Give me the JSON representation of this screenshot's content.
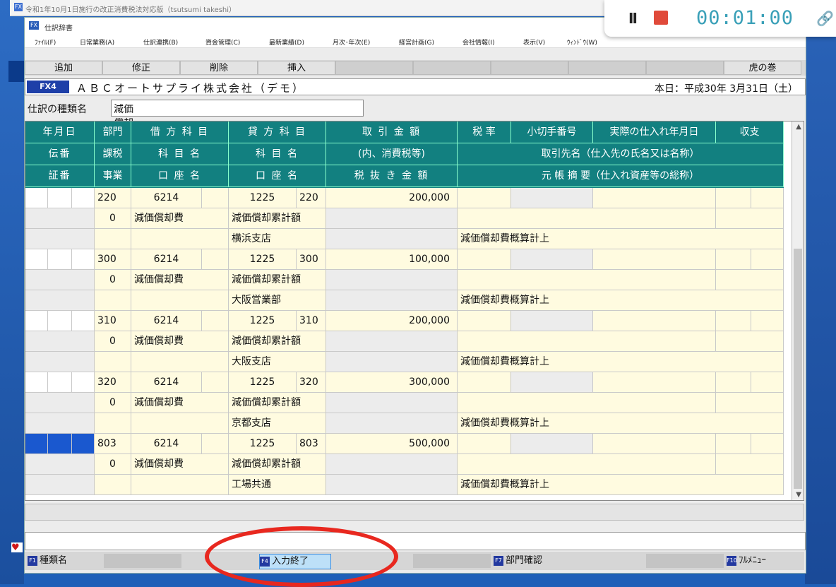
{
  "outer_title": "令和1年10月1日施行の改正消費税法対応版（tsutsumi takeshi）",
  "window_title": "仕訳辞書",
  "menu": [
    "ﾌｧｲﾙ(F)",
    "日常業務(A)",
    "仕訳連携(B)",
    "資金管理(C)",
    "最新業績(D)",
    "月次･年次(E)",
    "経営計画(G)",
    "会社情報(I)",
    "表示(V)",
    "ｳｨﾝﾄﾞｳ(W)"
  ],
  "toolbar": {
    "add": "追加",
    "edit": "修正",
    "delete": "削除",
    "insert": "挿入",
    "tora": "虎の巻"
  },
  "company": {
    "badge": "FX4",
    "name": "ＡＢＣオートサプライ株式会社（デモ）",
    "today": "本日：平成30年 3月31日（土）"
  },
  "kind": {
    "label": "仕訳の種類名",
    "value": "減価償却費　月割計上"
  },
  "headers": {
    "r1": [
      "年月日",
      "部門",
      "借 方 科 目",
      "貸 方 科 目",
      "取 引 金 額",
      "税 率",
      "小切手番号",
      "実際の仕入れ年月日",
      "収支"
    ],
    "r2": [
      "伝番",
      "課税",
      "科 目 名",
      "科 目 名",
      "(内、消費税等)",
      "取引先名（仕入先の氏名又は名称）"
    ],
    "r3": [
      "証番",
      "事業",
      "口 座 名",
      "口 座 名",
      "税 抜 き 金 額",
      "元 帳 摘 要（仕入れ資産等の総称）"
    ]
  },
  "entries": [
    {
      "dept": "220",
      "debit": "6214",
      "credit": "1225",
      "credit_dept": "220",
      "amount": "200,000",
      "tax": "0",
      "debit_name": "減価償却費",
      "credit_name": "減価償却累計額",
      "credit_account": "横浜支店",
      "memo": "減価償却費概算計上"
    },
    {
      "dept": "300",
      "debit": "6214",
      "credit": "1225",
      "credit_dept": "300",
      "amount": "100,000",
      "tax": "0",
      "debit_name": "減価償却費",
      "credit_name": "減価償却累計額",
      "credit_account": "大阪営業部",
      "memo": "減価償却費概算計上"
    },
    {
      "dept": "310",
      "debit": "6214",
      "credit": "1225",
      "credit_dept": "310",
      "amount": "200,000",
      "tax": "0",
      "debit_name": "減価償却費",
      "credit_name": "減価償却累計額",
      "credit_account": "大阪支店",
      "memo": "減価償却費概算計上"
    },
    {
      "dept": "320",
      "debit": "6214",
      "credit": "1225",
      "credit_dept": "320",
      "amount": "300,000",
      "tax": "0",
      "debit_name": "減価償却費",
      "credit_name": "減価償却累計額",
      "credit_account": "京都支店",
      "memo": "減価償却費概算計上"
    },
    {
      "dept": "803",
      "debit": "6214",
      "credit": "1225",
      "credit_dept": "803",
      "amount": "500,000",
      "tax": "0",
      "debit_name": "減価償却費",
      "credit_name": "減価償却累計額",
      "credit_account": "工場共通",
      "memo": "減価償却費概算計上"
    }
  ],
  "fkeys": {
    "f1": "種類名",
    "f4": "入力終了",
    "f7": "部門確認",
    "f10": "ﾌﾙﾒﾆｭｰ"
  },
  "fkey_codes": {
    "f1": "F1",
    "f4": "F4",
    "f7": "F7",
    "f10": "F10"
  },
  "recorder": {
    "pause": "II",
    "time": "00:01:00",
    "link": "🔗"
  },
  "icons": {
    "heart": "♥",
    "app_small": "FX",
    "scroll_up": "▲",
    "scroll_down": "▼"
  }
}
